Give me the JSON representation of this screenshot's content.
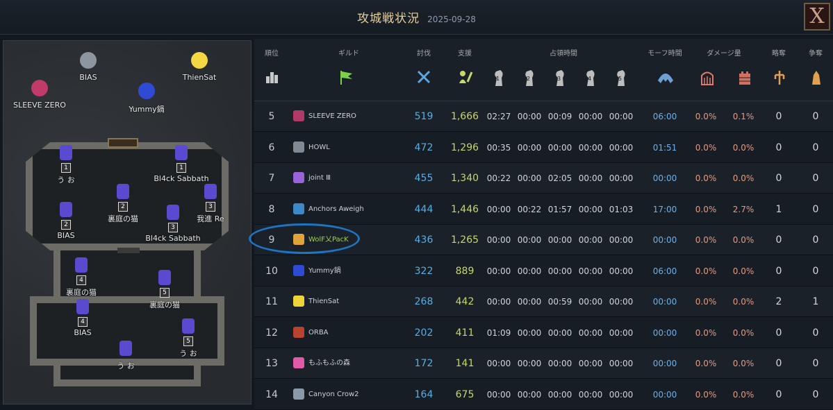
{
  "header": {
    "title": "攻城戦状況",
    "date": "2025-09-28",
    "close_label": "X"
  },
  "map": {
    "outside_markers": [
      {
        "label": "BIAS",
        "color": "#8c96a0"
      },
      {
        "label": "ThienSat",
        "color": "#f3d743"
      },
      {
        "label": "SLEEVE ZERO",
        "color": "#c03a6a"
      },
      {
        "label": "Yummy鍋",
        "color": "#2f4bd6"
      }
    ],
    "inside_markers": [
      {
        "label": "う お",
        "num": "1"
      },
      {
        "label": "Bl4ck Sabbath",
        "num": "1"
      },
      {
        "label": "裏庭の猫",
        "num": "2"
      },
      {
        "label": "我進 Re",
        "num": "3"
      },
      {
        "label": "BIAS",
        "num": "2"
      },
      {
        "label": "Bl4ck Sabbath",
        "num": "3"
      },
      {
        "label": "裏庭の猫",
        "num": "4"
      },
      {
        "label": "裏庭の猫",
        "num": "5"
      },
      {
        "label": "BIAS",
        "num": "4"
      },
      {
        "label": "う お",
        "num": "5"
      },
      {
        "label": "う お",
        "num": ""
      }
    ]
  },
  "table": {
    "headers": {
      "rank": "順位",
      "guild": "ギルド",
      "kill": "討伐",
      "support": "支援",
      "occupy": "占領時間",
      "morph": "モーフ時間",
      "damage": "ダメージ量",
      "raid": "略奪",
      "contest": "争奪"
    },
    "occupy_nums": [
      "1",
      "2",
      "3",
      "4",
      "5"
    ],
    "rows": [
      {
        "rank": "5",
        "guild": "SLEEVE ZERO",
        "icon": "#b23a68",
        "kill": "519",
        "support": "1,666",
        "t": [
          "02:27",
          "00:00",
          "00:09",
          "00:00",
          "00:00"
        ],
        "morph": "06:00",
        "dmg1": "0.0%",
        "dmg2": "0.1%",
        "raid": "0",
        "contest": "0"
      },
      {
        "rank": "6",
        "guild": "HOWL",
        "icon": "#7f8a94",
        "kill": "472",
        "support": "1,296",
        "t": [
          "00:35",
          "00:00",
          "00:00",
          "00:00",
          "00:00"
        ],
        "morph": "01:51",
        "dmg1": "0.0%",
        "dmg2": "0.0%",
        "raid": "0",
        "contest": "0"
      },
      {
        "rank": "7",
        "guild": "joint Ⅲ",
        "icon": "#9a63d8",
        "kill": "455",
        "support": "1,340",
        "t": [
          "00:22",
          "00:00",
          "02:05",
          "00:00",
          "00:00"
        ],
        "morph": "00:00",
        "dmg1": "0.0%",
        "dmg2": "0.0%",
        "raid": "0",
        "contest": "0"
      },
      {
        "rank": "8",
        "guild": "Anchors Aweigh",
        "icon": "#3d8ac7",
        "kill": "444",
        "support": "1,446",
        "t": [
          "00:00",
          "00:22",
          "01:57",
          "00:00",
          "01:03"
        ],
        "morph": "17:00",
        "dmg1": "0.0%",
        "dmg2": "2.7%",
        "raid": "1",
        "contest": "0"
      },
      {
        "rank": "9",
        "guild": "WolF乂PacK",
        "icon": "#e0a23a",
        "kill": "436",
        "support": "1,265",
        "t": [
          "00:00",
          "00:00",
          "00:00",
          "00:00",
          "00:00"
        ],
        "morph": "00:00",
        "dmg1": "0.0%",
        "dmg2": "0.0%",
        "raid": "0",
        "contest": "0",
        "own": true
      },
      {
        "rank": "10",
        "guild": "Yummy鍋",
        "icon": "#2f4bd6",
        "kill": "322",
        "support": "889",
        "t": [
          "00:00",
          "00:00",
          "00:00",
          "00:00",
          "00:00"
        ],
        "morph": "06:00",
        "dmg1": "0.0%",
        "dmg2": "0.0%",
        "raid": "0",
        "contest": "0"
      },
      {
        "rank": "11",
        "guild": "ThienSat",
        "icon": "#f0d23a",
        "kill": "268",
        "support": "442",
        "t": [
          "00:00",
          "00:00",
          "00:59",
          "00:00",
          "00:00"
        ],
        "morph": "00:00",
        "dmg1": "0.0%",
        "dmg2": "0.0%",
        "raid": "2",
        "contest": "1"
      },
      {
        "rank": "12",
        "guild": "ORBA",
        "icon": "#b8442f",
        "kill": "202",
        "support": "411",
        "t": [
          "01:09",
          "00:00",
          "00:00",
          "00:00",
          "00:00"
        ],
        "morph": "00:00",
        "dmg1": "0.0%",
        "dmg2": "0.0%",
        "raid": "0",
        "contest": "0"
      },
      {
        "rank": "13",
        "guild": "もふもふの森",
        "icon": "#e05aa8",
        "kill": "172",
        "support": "141",
        "t": [
          "00:00",
          "00:00",
          "00:00",
          "00:00",
          "00:00"
        ],
        "morph": "00:00",
        "dmg1": "0.0%",
        "dmg2": "0.0%",
        "raid": "0",
        "contest": "0"
      },
      {
        "rank": "14",
        "guild": "Canyon Crow2",
        "icon": "#8a9aa8",
        "kill": "164",
        "support": "675",
        "t": [
          "00:00",
          "00:00",
          "00:00",
          "00:00",
          "00:00"
        ],
        "morph": "00:00",
        "dmg1": "0.0%",
        "dmg2": "0.0%",
        "raid": "0",
        "contest": "0"
      }
    ]
  },
  "colors": {
    "kill": "#58aee6",
    "support": "#c7d76a",
    "damage": "#e39b82",
    "morph": "#6fb0e8",
    "highlight": "#1d75c2",
    "own_guild": "#9fd14a"
  }
}
